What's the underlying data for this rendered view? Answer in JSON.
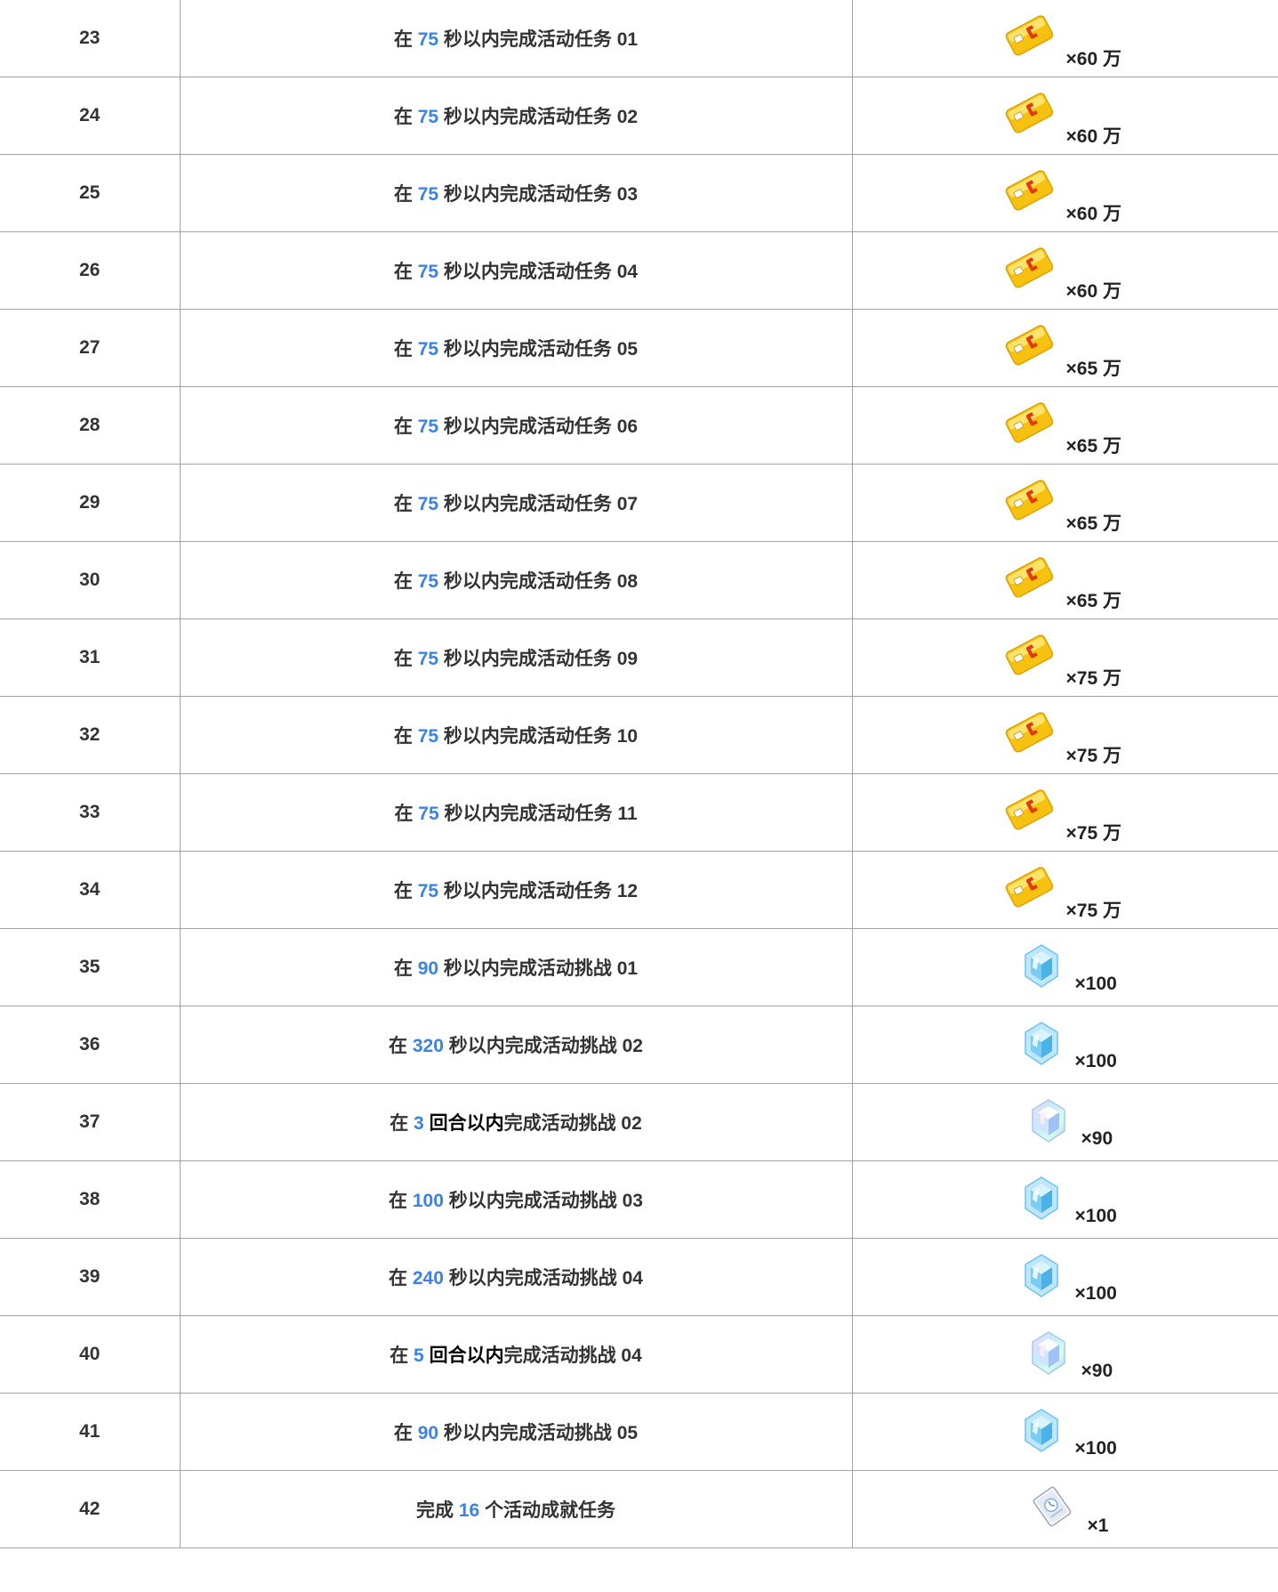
{
  "table": {
    "rows": [
      {
        "id": "23",
        "pre": "在 ",
        "num": "75",
        "mid": " 秒以内完成活动任务 ",
        "mid_dark": "",
        "suffix": "",
        "code": "01",
        "reward_icon": "coin-card-icon",
        "reward_qty": "×60 万"
      },
      {
        "id": "24",
        "pre": "在 ",
        "num": "75",
        "mid": " 秒以内完成活动任务 ",
        "mid_dark": "",
        "suffix": "",
        "code": "02",
        "reward_icon": "coin-card-icon",
        "reward_qty": "×60 万"
      },
      {
        "id": "25",
        "pre": "在 ",
        "num": "75",
        "mid": " 秒以内完成活动任务 ",
        "mid_dark": "",
        "suffix": "",
        "code": "03",
        "reward_icon": "coin-card-icon",
        "reward_qty": "×60 万"
      },
      {
        "id": "26",
        "pre": "在 ",
        "num": "75",
        "mid": " 秒以内完成活动任务 ",
        "mid_dark": "",
        "suffix": "",
        "code": "04",
        "reward_icon": "coin-card-icon",
        "reward_qty": "×60 万"
      },
      {
        "id": "27",
        "pre": "在 ",
        "num": "75",
        "mid": " 秒以内完成活动任务 ",
        "mid_dark": "",
        "suffix": "",
        "code": "05",
        "reward_icon": "coin-card-icon",
        "reward_qty": "×65 万"
      },
      {
        "id": "28",
        "pre": "在 ",
        "num": "75",
        "mid": " 秒以内完成活动任务 ",
        "mid_dark": "",
        "suffix": "",
        "code": "06",
        "reward_icon": "coin-card-icon",
        "reward_qty": "×65 万"
      },
      {
        "id": "29",
        "pre": "在 ",
        "num": "75",
        "mid": " 秒以内完成活动任务 ",
        "mid_dark": "",
        "suffix": "",
        "code": "07",
        "reward_icon": "coin-card-icon",
        "reward_qty": "×65 万"
      },
      {
        "id": "30",
        "pre": "在 ",
        "num": "75",
        "mid": " 秒以内完成活动任务 ",
        "mid_dark": "",
        "suffix": "",
        "code": "08",
        "reward_icon": "coin-card-icon",
        "reward_qty": "×65 万"
      },
      {
        "id": "31",
        "pre": "在 ",
        "num": "75",
        "mid": " 秒以内完成活动任务 ",
        "mid_dark": "",
        "suffix": "",
        "code": "09",
        "reward_icon": "coin-card-icon",
        "reward_qty": "×75 万"
      },
      {
        "id": "32",
        "pre": "在 ",
        "num": "75",
        "mid": " 秒以内完成活动任务 ",
        "mid_dark": "",
        "suffix": "",
        "code": "10",
        "reward_icon": "coin-card-icon",
        "reward_qty": "×75 万"
      },
      {
        "id": "33",
        "pre": "在 ",
        "num": "75",
        "mid": " 秒以内完成活动任务 ",
        "mid_dark": "",
        "suffix": "",
        "code": "11",
        "reward_icon": "coin-card-icon",
        "reward_qty": "×75 万"
      },
      {
        "id": "34",
        "pre": "在 ",
        "num": "75",
        "mid": " 秒以内完成活动任务 ",
        "mid_dark": "",
        "suffix": "",
        "code": "12",
        "reward_icon": "coin-card-icon",
        "reward_qty": "×75 万"
      },
      {
        "id": "35",
        "pre": "在 ",
        "num": "90",
        "mid": " 秒以内完成活动挑战 ",
        "mid_dark": "",
        "suffix": "",
        "code": "01",
        "reward_icon": "crystal-icon",
        "reward_qty": "×100"
      },
      {
        "id": "36",
        "pre": "在 ",
        "num": "320",
        "mid": " 秒以内完成活动挑战 ",
        "mid_dark": "",
        "suffix": "",
        "code": "02",
        "reward_icon": "crystal-icon",
        "reward_qty": "×100"
      },
      {
        "id": "37",
        "pre": "在 ",
        "num": "3",
        "mid": "",
        "mid_dark": " 回合以内",
        "suffix": "完成活动挑战 ",
        "code": "02",
        "reward_icon": "rainbow-crystal-icon",
        "reward_qty": "×90"
      },
      {
        "id": "38",
        "pre": "在 ",
        "num": "100",
        "mid": " 秒以内完成活动挑战 ",
        "mid_dark": "",
        "suffix": "",
        "code": "03",
        "reward_icon": "crystal-icon",
        "reward_qty": "×100"
      },
      {
        "id": "39",
        "pre": "在 ",
        "num": "240",
        "mid": " 秒以内完成活动挑战 ",
        "mid_dark": "",
        "suffix": "",
        "code": "04",
        "reward_icon": "crystal-icon",
        "reward_qty": "×100"
      },
      {
        "id": "40",
        "pre": "在 ",
        "num": "5",
        "mid": "",
        "mid_dark": " 回合以内",
        "suffix": "完成活动挑战 ",
        "code": "04",
        "reward_icon": "rainbow-crystal-icon",
        "reward_qty": "×90"
      },
      {
        "id": "41",
        "pre": "在 ",
        "num": "90",
        "mid": " 秒以内完成活动挑战 ",
        "mid_dark": "",
        "suffix": "",
        "code": "05",
        "reward_icon": "crystal-icon",
        "reward_qty": "×100"
      },
      {
        "id": "42",
        "pre": "完成 ",
        "num": "16",
        "mid": " 个活动成就任务",
        "mid_dark": "",
        "suffix": "",
        "code": "",
        "reward_icon": "ticket-icon",
        "reward_qty": "×1"
      }
    ]
  },
  "colors": {
    "number_highlight": "#3b82e6",
    "text": "#333333",
    "border": "#a3a3a3"
  }
}
